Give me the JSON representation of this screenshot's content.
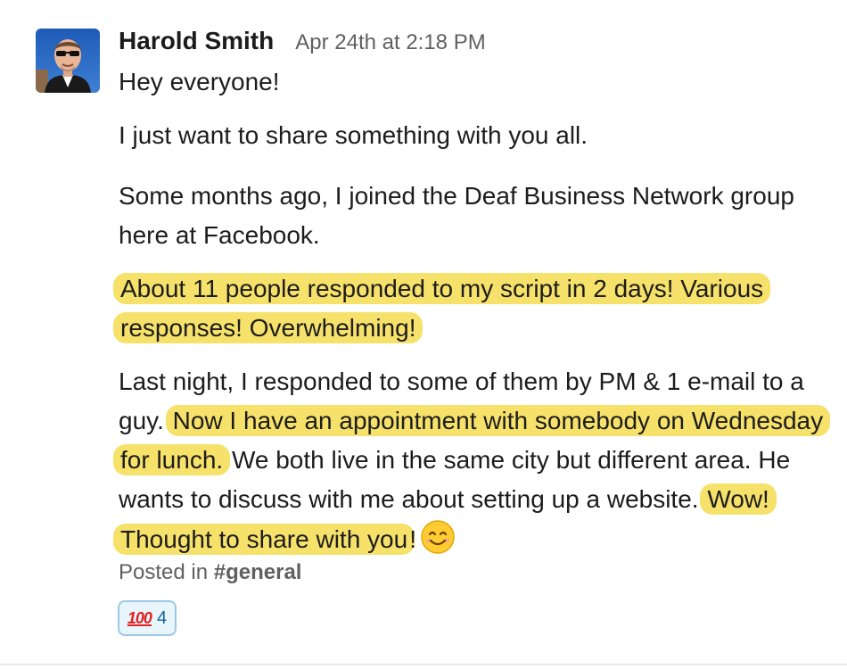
{
  "message": {
    "author": "Harold Smith",
    "timestamp": "Apr 24th at 2:18 PM",
    "paragraphs": {
      "p1": "Hey everyone!",
      "p2": "I just want to share something with you all.",
      "p3": "Some months ago, I joined the Deaf Business Network group here at Facebook.",
      "p4": "About 11 people responded to my script in 2 days! Various responses! Overwhelming!",
      "p5": {
        "part1": "Last night, I responded to some of them by PM & 1 e-mail to a guy.",
        "part2": "Now I have an appointment with somebody on Wednesday for lunch.",
        "part3": "We both live in the same city but different area. He wants to discuss with me about setting up a website.",
        "part4": "Wow! Thought to share with you",
        "part5": "!"
      }
    },
    "posted_in_label": "Posted in",
    "channel": "#general",
    "reaction": {
      "emoji": "100",
      "emoji_name": "hundred-points-icon",
      "count": "4"
    },
    "icons": {
      "smile": "smiling-face-icon"
    },
    "colors": {
      "highlight": "#f6e26a",
      "reaction_border": "#9cc8e6",
      "reaction_bg": "#e8f5fa",
      "reaction_count": "#1264a3"
    }
  }
}
